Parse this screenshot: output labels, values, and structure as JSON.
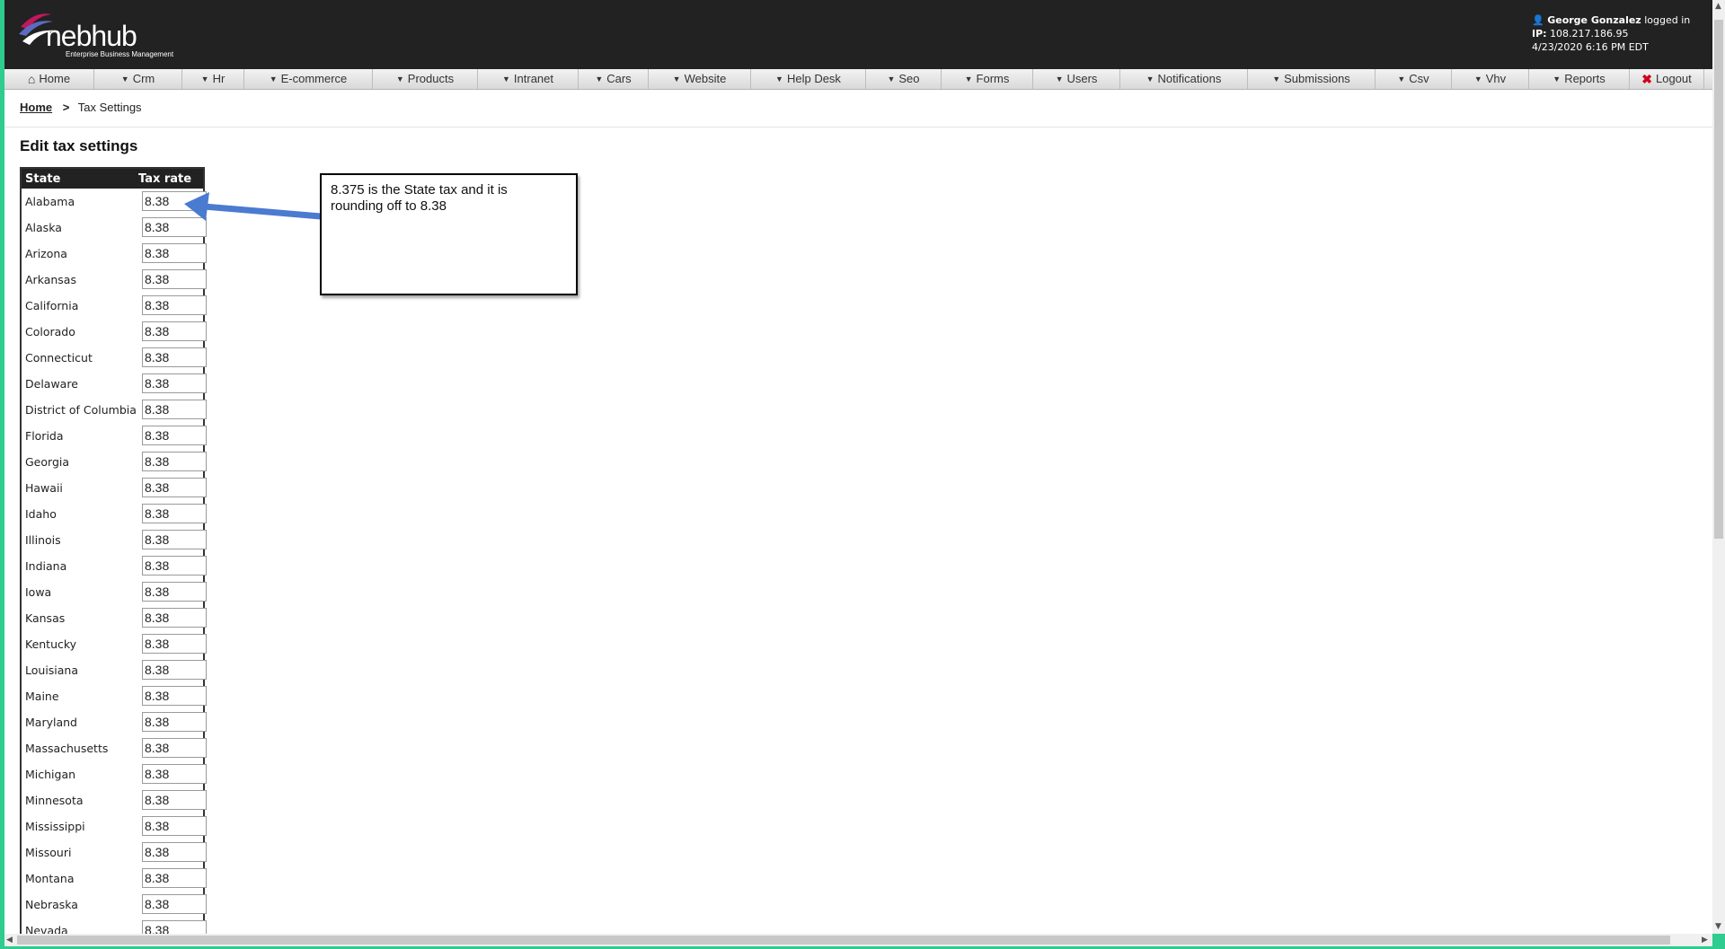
{
  "header": {
    "logo_text": "nebhub",
    "logo_tagline": "Enterprise Business Management",
    "user_name": "George Gonzalez",
    "logged_in_text": "logged in",
    "ip_label": "IP:",
    "ip_value": "108.217.186.95",
    "datetime": "4/23/2020 6:16 PM EDT",
    "user_icon": "user-icon"
  },
  "nav": {
    "items": [
      {
        "label": "Home",
        "icon": "home-icon"
      },
      {
        "label": "Crm",
        "icon": "caret-down-icon"
      },
      {
        "label": "Hr",
        "icon": "caret-down-icon"
      },
      {
        "label": "E-commerce",
        "icon": "caret-down-icon"
      },
      {
        "label": "Products",
        "icon": "caret-down-icon"
      },
      {
        "label": "Intranet",
        "icon": "caret-down-icon"
      },
      {
        "label": "Cars",
        "icon": "caret-down-icon"
      },
      {
        "label": "Website",
        "icon": "caret-down-icon"
      },
      {
        "label": "Help Desk",
        "icon": "caret-down-icon"
      },
      {
        "label": "Seo",
        "icon": "caret-down-icon"
      },
      {
        "label": "Forms",
        "icon": "caret-down-icon"
      },
      {
        "label": "Users",
        "icon": "caret-down-icon"
      },
      {
        "label": "Notifications",
        "icon": "caret-down-icon"
      },
      {
        "label": "Submissions",
        "icon": "caret-down-icon"
      },
      {
        "label": "Csv",
        "icon": "caret-down-icon"
      },
      {
        "label": "Vhv",
        "icon": "caret-down-icon"
      },
      {
        "label": "Reports",
        "icon": "caret-down-icon"
      },
      {
        "label": "Logout",
        "icon": "close-icon"
      }
    ]
  },
  "breadcrumb": {
    "home": "Home",
    "separator": ">",
    "current": "Tax Settings"
  },
  "page_title": "Edit tax settings",
  "table": {
    "headers": {
      "state": "State",
      "tax_rate": "Tax rate"
    },
    "rows": [
      {
        "state": "Alabama",
        "rate": "8.38"
      },
      {
        "state": "Alaska",
        "rate": "8.38"
      },
      {
        "state": "Arizona",
        "rate": "8.38"
      },
      {
        "state": "Arkansas",
        "rate": "8.38"
      },
      {
        "state": "California",
        "rate": "8.38"
      },
      {
        "state": "Colorado",
        "rate": "8.38"
      },
      {
        "state": "Connecticut",
        "rate": "8.38"
      },
      {
        "state": "Delaware",
        "rate": "8.38"
      },
      {
        "state": "District of Columbia",
        "rate": "8.38"
      },
      {
        "state": "Florida",
        "rate": "8.38"
      },
      {
        "state": "Georgia",
        "rate": "8.38"
      },
      {
        "state": "Hawaii",
        "rate": "8.38"
      },
      {
        "state": "Idaho",
        "rate": "8.38"
      },
      {
        "state": "Illinois",
        "rate": "8.38"
      },
      {
        "state": "Indiana",
        "rate": "8.38"
      },
      {
        "state": "Iowa",
        "rate": "8.38"
      },
      {
        "state": "Kansas",
        "rate": "8.38"
      },
      {
        "state": "Kentucky",
        "rate": "8.38"
      },
      {
        "state": "Louisiana",
        "rate": "8.38"
      },
      {
        "state": "Maine",
        "rate": "8.38"
      },
      {
        "state": "Maryland",
        "rate": "8.38"
      },
      {
        "state": "Massachusetts",
        "rate": "8.38"
      },
      {
        "state": "Michigan",
        "rate": "8.38"
      },
      {
        "state": "Minnesota",
        "rate": "8.38"
      },
      {
        "state": "Mississippi",
        "rate": "8.38"
      },
      {
        "state": "Missouri",
        "rate": "8.38"
      },
      {
        "state": "Montana",
        "rate": "8.38"
      },
      {
        "state": "Nebraska",
        "rate": "8.38"
      },
      {
        "state": "Nevada",
        "rate": "8.38"
      }
    ]
  },
  "annotation": {
    "text": "8.375 is the State tax and it is rounding off to 8.38",
    "arrow_color": "#4a7bd0"
  },
  "colors": {
    "header_bg": "#222222",
    "frame_border": "#2ecc8f",
    "logout_x": "#d0021b"
  }
}
